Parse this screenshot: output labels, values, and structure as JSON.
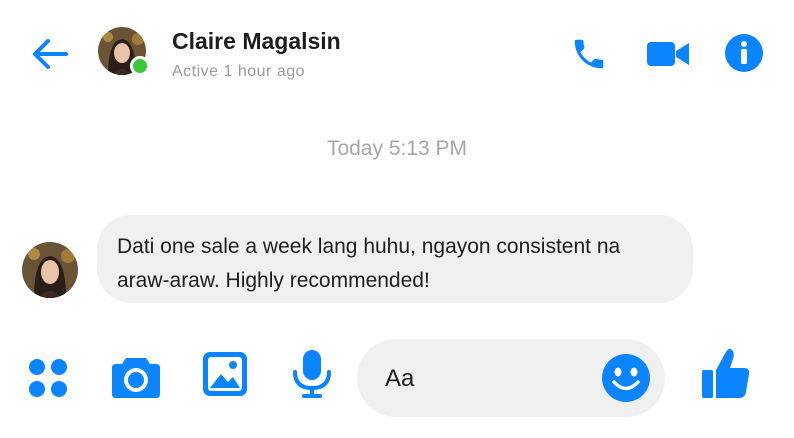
{
  "header": {
    "contact_name": "Claire Magalsin",
    "status": "Active 1 hour ago",
    "icons": {
      "back": "back-arrow-icon",
      "call": "phone-icon",
      "video": "video-camera-icon",
      "info": "info-icon"
    }
  },
  "conversation": {
    "timestamp": "Today 5:13 PM",
    "messages": [
      {
        "sender": "Claire Magalsin",
        "direction": "incoming",
        "text": "Dati one sale a week lang huhu, ngayon consistent na araw-araw. Highly recommended!"
      }
    ]
  },
  "composer": {
    "placeholder": "Aa",
    "icons": {
      "menu": "grid-dots-icon",
      "camera": "camera-icon",
      "gallery": "image-icon",
      "mic": "microphone-icon",
      "emoji": "emoji-icon",
      "like": "thumbs-up-icon"
    }
  },
  "colors": {
    "accent": "#0a84ff",
    "online": "#3cc83c",
    "bubble": "#f0f0f0",
    "text": "#1c1e21",
    "muted": "#a6a6a6"
  }
}
